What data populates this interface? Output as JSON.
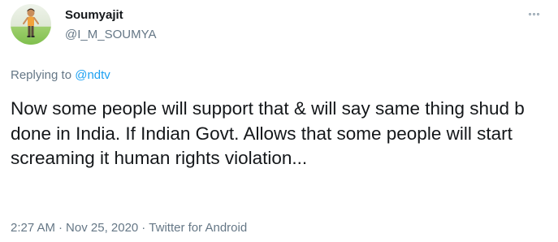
{
  "tweet": {
    "author": {
      "display_name": "Soumyajit",
      "handle": "@I_M_SOUMYA",
      "avatar_icon": "avatar-person-icon"
    },
    "more_icon": "more-options-icon",
    "reply": {
      "prefix": "Replying to",
      "to": "@ndtv"
    },
    "text": "Now some people will support that & will say same thing shud b done in India. If Indian Govt. Allows that some people will start screaming it human rights violation...",
    "meta": {
      "time": "2:27 AM",
      "separator": "·",
      "date": "Nov 25, 2020",
      "source": "Twitter for Android"
    }
  },
  "colors": {
    "text": "#14171a",
    "secondary": "#657786",
    "link": "#1da1f2",
    "background": "#ffffff"
  }
}
